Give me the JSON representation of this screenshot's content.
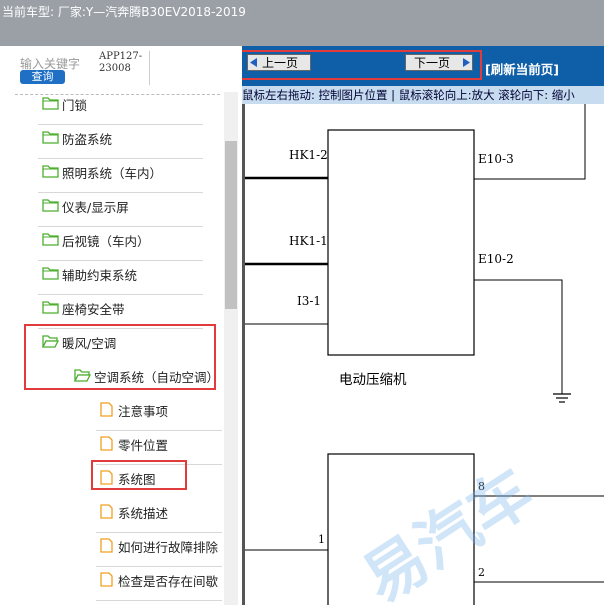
{
  "title": "当前车型:  厂家:Y—汽奔腾B30EV2018-2019",
  "search": {
    "label": "输入关键字",
    "button": "查询",
    "app_code_line1": "APP127-",
    "app_code_line2": "23008"
  },
  "tree": [
    {
      "label": "门锁"
    },
    {
      "label": "防盗系统"
    },
    {
      "label": "照明系统（车内）"
    },
    {
      "label": "仪表/显示屏"
    },
    {
      "label": "后视镜（车内）"
    },
    {
      "label": "辅助约束系统"
    },
    {
      "label": "座椅安全带"
    },
    {
      "label": "暖风/空调"
    },
    {
      "label": "空调系统（自动空调）"
    },
    {
      "label": "注意事项"
    },
    {
      "label": "零件位置"
    },
    {
      "label": "系统图"
    },
    {
      "label": "系统描述"
    },
    {
      "label": "如何进行故障排除"
    },
    {
      "label": "检查是否存在间歇"
    }
  ],
  "toolbar": {
    "prev": "上一页",
    "next": "下一页",
    "refresh": "[刷新当前页]",
    "hint": "鼠标左右拖动: 控制图片位置 | 鼠标滚轮向上:放大  滚轮向下: 缩小"
  },
  "diagram": {
    "labels": {
      "hk1_2": "HK1-2",
      "hk1_1": "HK1-1",
      "i3_1": "I3-1",
      "e10_3": "E10-3",
      "e10_2": "E10-2",
      "component": "电动压缩机",
      "pin1": "1",
      "pin8": "8",
      "pin2": "2"
    },
    "watermark": "易汽车"
  },
  "colors": {
    "titlebar": "#9aa0a6",
    "toolbar": "#0f5ea8",
    "hint_bg": "#c8dcf0",
    "highlight": "#e23b3b",
    "folder": "#4caf2e",
    "doc": "#f0a020"
  }
}
